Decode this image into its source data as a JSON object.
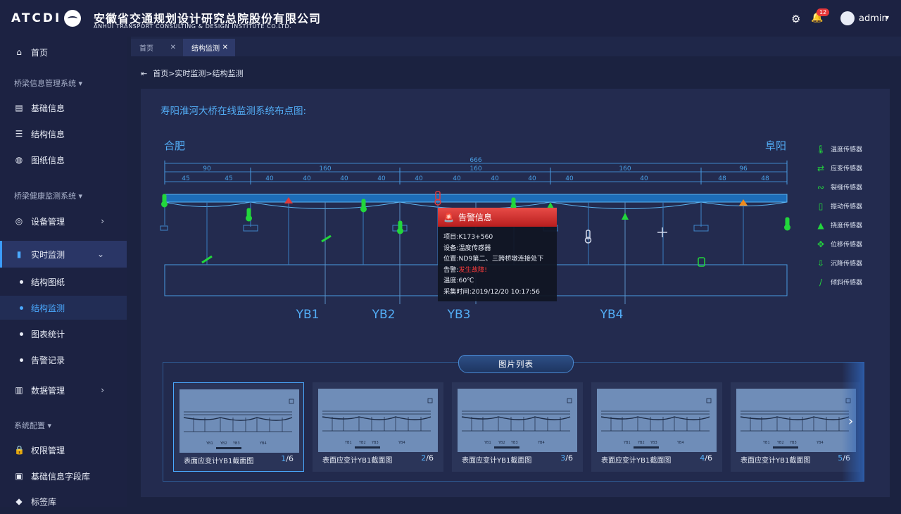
{
  "header": {
    "logo_text": "ATCDI",
    "org_cn": "安徽省交通规划设计研究总院股份有限公司",
    "org_en": "ANHUI TRANSPORT CONSULTING & DESIGN INSTITUTE CO.LTD.",
    "notifications": "12",
    "user": "admin"
  },
  "sidebar": {
    "home": "首页",
    "section1": "桥梁信息管理系统",
    "basic_info": "基础信息",
    "struct_info": "结构信息",
    "drawing_info": "图纸信息",
    "section2": "桥梁健康监测系统",
    "device_mgmt": "设备管理",
    "realtime": "实时监测",
    "sub_struct_drawing": "结构图纸",
    "sub_struct_monitor": "结构监测",
    "sub_chart_stats": "图表统计",
    "sub_alarm_records": "告警记录",
    "data_mgmt": "数据管理",
    "section3": "系统配置",
    "permission": "权限管理",
    "field_lib": "基础信息字段库",
    "tag_lib": "标签库"
  },
  "tabs": {
    "home": "首页",
    "current": "结构监测"
  },
  "breadcrumb": "首页>实时监测>结构监测",
  "map": {
    "title": "寿阳淮河大桥在线监测系统布点图:",
    "city_left": "合肥",
    "city_right": "阜阳",
    "dims_top": "666",
    "dims_mid": [
      "90",
      "160",
      "160",
      "160",
      "96"
    ],
    "dims_low": [
      "45",
      "45",
      "40",
      "40",
      "40",
      "40",
      "40",
      "40",
      "40",
      "40",
      "40",
      "40",
      "48",
      "48"
    ],
    "sections": [
      "YB1",
      "YB2",
      "YB3",
      "YB4"
    ]
  },
  "legend": [
    {
      "icon": "thermometer-icon",
      "label": "温度传感器"
    },
    {
      "icon": "strain-icon",
      "label": "应变传感器"
    },
    {
      "icon": "crack-icon",
      "label": "裂缝传感器"
    },
    {
      "icon": "vibration-icon",
      "label": "振动传感器"
    },
    {
      "icon": "deflection-icon",
      "label": "挠度传感器"
    },
    {
      "icon": "displacement-icon",
      "label": "位移传感器"
    },
    {
      "icon": "settlement-icon",
      "label": "沉降传感器"
    },
    {
      "icon": "tilt-icon",
      "label": "倾斜传感器"
    }
  ],
  "alarm": {
    "title": "告警信息",
    "project_k": "项目:",
    "project_v": "K173+560",
    "device_k": "设备:",
    "device_v": "温度传感器",
    "location_k": "位置:",
    "location_v": "ND9第二、三跨桥墩连接处下",
    "alarm_k": "告警:",
    "alarm_v": "发生故障!",
    "temp_k": "温度:",
    "temp_v": "60℃",
    "time_k": "采集时间:",
    "time_v": "2019/12/20 10:17:56"
  },
  "gallery": {
    "title": "图片列表",
    "items": [
      {
        "caption": "表面应变计YB1截面图",
        "page": "1",
        "total": "/6"
      },
      {
        "caption": "表面应变计YB1截面图",
        "page": "2",
        "total": "/6"
      },
      {
        "caption": "表面应变计YB1截面图",
        "page": "3",
        "total": "/6"
      },
      {
        "caption": "表面应变计YB1截面图",
        "page": "4",
        "total": "/6"
      },
      {
        "caption": "表面应变计YB1截面图",
        "page": "5",
        "total": "/6"
      }
    ]
  },
  "colors": {
    "accent": "#53aef7",
    "sensor_green": "#22d63c",
    "alarm_red": "#e5373a",
    "warn_orange": "#f08a1c"
  }
}
